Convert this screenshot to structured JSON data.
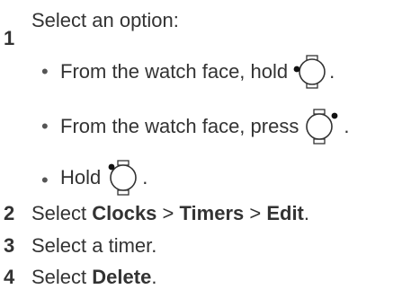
{
  "step1": {
    "number": "1",
    "intro": "Select an option:",
    "options": [
      {
        "text": "From the watch face, hold",
        "end": ".",
        "icon": "watch-button-left-icon"
      },
      {
        "text": "From the watch face, press",
        "end": ".",
        "icon": "watch-button-right-icon"
      },
      {
        "text": "Hold",
        "end": ".",
        "icon": "watch-button-top-left-icon"
      }
    ]
  },
  "step2": {
    "number": "2",
    "prefix": "Select ",
    "item1": "Clocks",
    "sep1": " > ",
    "item2": "Timers",
    "sep2": " > ",
    "item3": "Edit",
    "end": "."
  },
  "step3": {
    "number": "3",
    "text": "Select a timer."
  },
  "step4": {
    "number": "4",
    "prefix": "Select ",
    "item": "Delete",
    "end": "."
  },
  "bullet_glyph": "•"
}
